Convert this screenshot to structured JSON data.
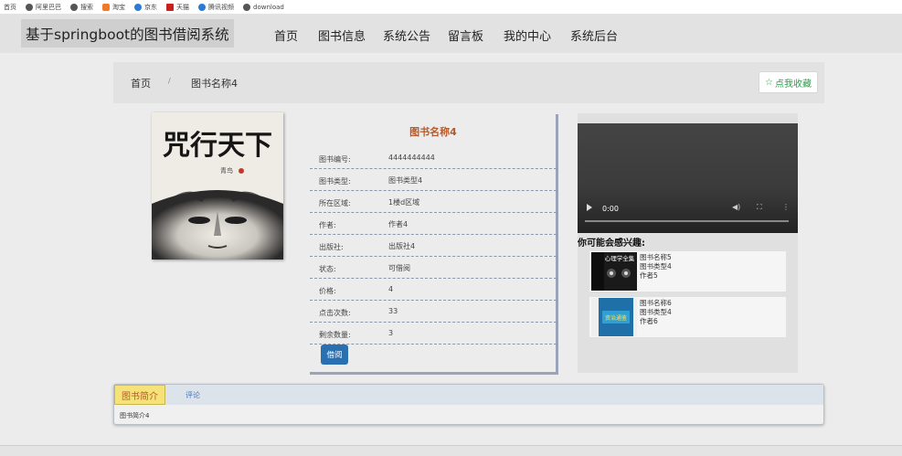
{
  "bookmarks": [
    {
      "label": "首页",
      "color": "#ffffff"
    },
    {
      "label": "阿里巴巴",
      "color": "#555555"
    },
    {
      "label": "搜索",
      "color": "#555555"
    },
    {
      "label": "淘宝",
      "color": "#f07a2c"
    },
    {
      "label": "京东",
      "color": "#2a7ad6"
    },
    {
      "label": "天猫",
      "color": "#c8201e"
    },
    {
      "label": "腾讯视频",
      "color": "#2a7ad6"
    },
    {
      "label": "download",
      "color": "#555555"
    }
  ],
  "nav": {
    "brand": "基于springboot的图书借阅系统",
    "items": [
      "首页",
      "图书信息",
      "系统公告",
      "留言板",
      "我的中心",
      "系统后台"
    ]
  },
  "breadcrumb": {
    "home": "首页",
    "sep": "/",
    "current": "图书名称4"
  },
  "favorite_label": "点我收藏",
  "book": {
    "title": "图书名称4",
    "cover_title": "咒行天下",
    "cover_author": "青鸟",
    "rows": [
      {
        "key": "图书编号:",
        "value": "4444444444"
      },
      {
        "key": "图书类型:",
        "value": "图书类型4"
      },
      {
        "key": "所在区域:",
        "value": "1楼d区域"
      },
      {
        "key": "作者:",
        "value": "作者4"
      },
      {
        "key": "出版社:",
        "value": "出版社4"
      },
      {
        "key": "状态:",
        "value": "可借阅"
      },
      {
        "key": "价格:",
        "value": "4"
      },
      {
        "key": "点击次数:",
        "value": "33"
      },
      {
        "key": "剩余数量:",
        "value": "3"
      }
    ],
    "borrow_label": "借阅"
  },
  "video": {
    "time": "0:00"
  },
  "recommend": {
    "heading": "你可能会感兴趣:",
    "items": [
      {
        "name": "图书名称5",
        "type": "图书类型4",
        "author": "作者5",
        "cover_text": "心理学全集"
      },
      {
        "name": "图书名称6",
        "type": "图书类型4",
        "author": "作者6",
        "cover_text": "资治通鉴"
      }
    ]
  },
  "tabs": {
    "active": "图书简介",
    "other": "评论",
    "content": "图书简介4"
  }
}
